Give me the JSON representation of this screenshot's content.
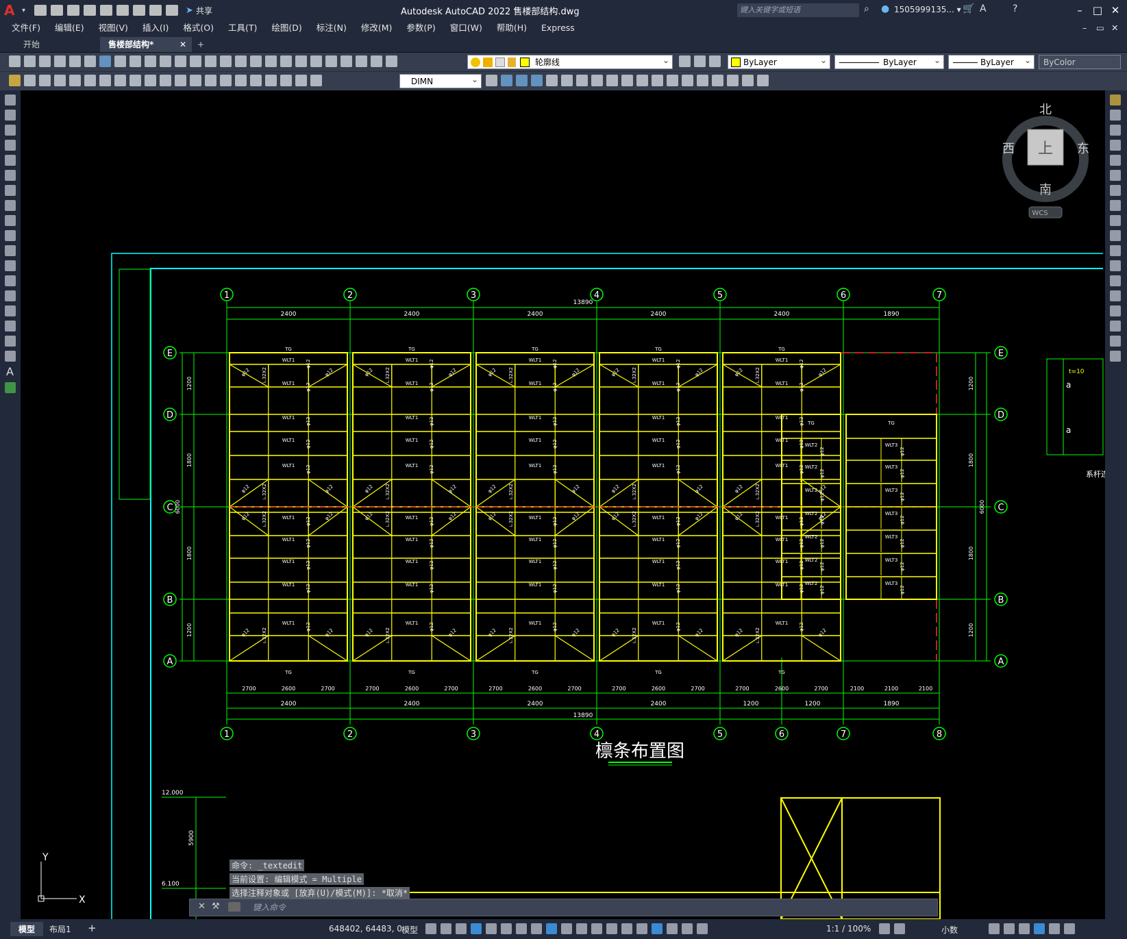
{
  "titlebar": {
    "app_title": "Autodesk AutoCAD 2022    售楼部结构.dwg",
    "share_label": "共享",
    "search_placeholder": "键入关键字或短语",
    "user": "1505999135... ▾"
  },
  "menu": [
    "文件(F)",
    "编辑(E)",
    "视图(V)",
    "插入(I)",
    "格式(O)",
    "工具(T)",
    "绘图(D)",
    "标注(N)",
    "修改(M)",
    "参数(P)",
    "窗口(W)",
    "帮助(H)",
    "Express"
  ],
  "tabs": {
    "start": "开始",
    "drawing": "售楼部结构*",
    "add": "+"
  },
  "toolbar": {
    "layer": "轮廓线",
    "color": "ByLayer",
    "linetype": "ByLayer",
    "lineweight": "ByLayer",
    "plotstyle": "ByColor",
    "dimstyle": "DIMN"
  },
  "viewcube": {
    "north": "北",
    "south": "南",
    "east": "东",
    "west": "西",
    "face": "上",
    "wcs": "WCS"
  },
  "drawing": {
    "title": "檩条布置图",
    "top_total": "13890",
    "bottom_total": "13890",
    "top_axes": [
      "1",
      "2",
      "3",
      "4",
      "5",
      "6",
      "7"
    ],
    "bottom_axes": [
      "1",
      "2",
      "3",
      "4",
      "5",
      "6",
      "7",
      "8"
    ],
    "row_axes": [
      "E",
      "D",
      "C",
      "B",
      "A"
    ],
    "top_spans": [
      "2400",
      "2400",
      "2400",
      "2400",
      "2400",
      "1890"
    ],
    "bottom_spans": [
      "2400",
      "2400",
      "2400",
      "2400",
      "1200",
      "1200",
      "1890"
    ],
    "sub_spans": [
      "2700",
      "2600",
      "2700",
      "2700",
      "2600",
      "2700",
      "2700",
      "2600",
      "2700",
      "2700",
      "2600",
      "2700",
      "2700",
      "2600",
      "2700",
      "2100",
      "2100",
      "2100"
    ],
    "left_dims": [
      "1200",
      "1800",
      "6000",
      "1800",
      "1200"
    ],
    "right_dims": [
      "1200",
      "1800",
      "6000",
      "1800",
      "1200"
    ],
    "purlin_label": "WLT1",
    "purlin_label2": "WLT2",
    "purlin_label3": "WLT3",
    "rod_label": "φ12",
    "brace_label": "∟32X2",
    "tie_label": "TG",
    "elev_top": "12.000",
    "elev_bottom": "6.100",
    "elev_span": "5900",
    "side_note": "系杆连",
    "side_t": "t=10",
    "side_a": "a"
  },
  "command": {
    "history": [
      "命令: _textedit",
      "当前设置: 编辑模式 = Multiple",
      "选择注释对象或 [放弃(U)/模式(M)]: *取消*"
    ],
    "placeholder": "键入命令"
  },
  "status": {
    "tab_model": "模型",
    "tab_layout": "布局1",
    "coords": "648402, 64483, 0",
    "model": "模型",
    "scale": "1:1 / 100%",
    "units": "小数"
  }
}
